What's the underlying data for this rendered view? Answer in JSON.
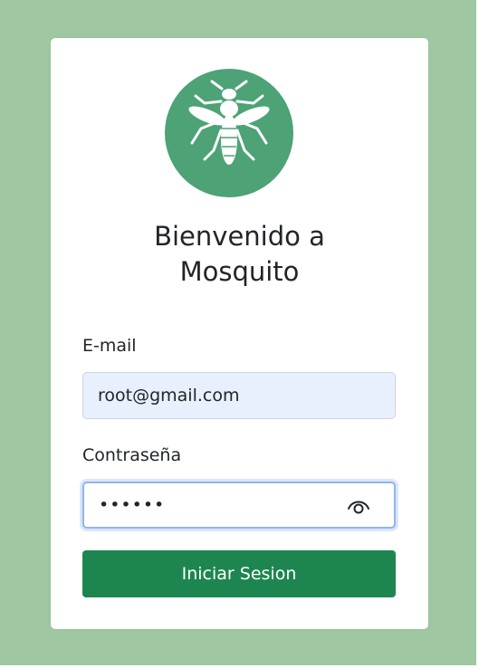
{
  "app": {
    "title_line1": "Bienvenido a",
    "title_line2": "Mosquito",
    "logo_icon": "mosquito-icon"
  },
  "form": {
    "email_label": "E-mail",
    "email_value": "root@gmail.com",
    "password_label": "Contraseña",
    "password_value": "123456",
    "password_toggle_icon": "eye-icon",
    "submit_label": "Iniciar Sesion"
  },
  "colors": {
    "background": "#9fc8a2",
    "logo_circle": "#4da276",
    "primary_button": "#1d8650",
    "email_fill": "#e8f0fe",
    "focus_border": "#8fb4f0"
  }
}
